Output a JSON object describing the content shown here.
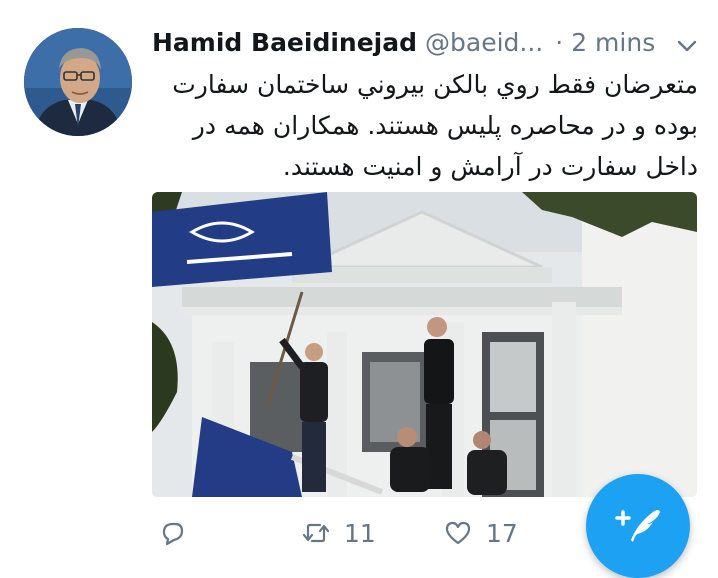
{
  "tweet": {
    "author": {
      "display_name": "Hamid Baeidinejad",
      "handle": "@baeid...",
      "avatar_icon": "profile-photo"
    },
    "separator": "·",
    "time": "2 mins",
    "menu_icon": "chevron-down-icon",
    "text_lines": [
      "متعرضان فقط روي بالكن بيروني ساختمان سفارت",
      "بوده و در محاصره پليس هستند. همكاران همه در",
      "داخل سفارت در آرامش و امنيت هستند."
    ],
    "media": {
      "kind": "photo",
      "icon": "embassy-balcony-photo"
    },
    "actions": {
      "reply": {
        "icon": "reply-icon",
        "count": ""
      },
      "retweet": {
        "icon": "retweet-icon",
        "count": "11"
      },
      "like": {
        "icon": "heart-icon",
        "count": "17"
      }
    }
  },
  "compose_button": {
    "icon": "compose-tweet-icon"
  },
  "colors": {
    "accent": "#1da1f2",
    "secondary_text": "#657786",
    "primary_text": "#14171a"
  }
}
